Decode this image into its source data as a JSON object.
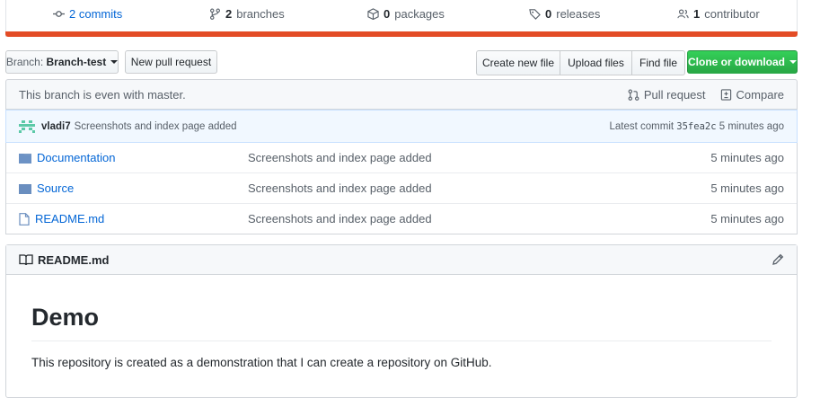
{
  "summary": {
    "commits": "2 commits",
    "branches_num": "2",
    "branches_label": "branches",
    "packages_num": "0",
    "packages_label": "packages",
    "releases_num": "0",
    "releases_label": "releases",
    "contributors_num": "1",
    "contributors_label": "contributor",
    "language_bar_color": "#e34c26"
  },
  "toolbar": {
    "branch_label": "Branch:",
    "branch_name": "Branch-test",
    "new_pr": "New pull request",
    "create_file": "Create new file",
    "upload_files": "Upload files",
    "find_file": "Find file",
    "clone": "Clone or download"
  },
  "branch_info": {
    "status": "This branch is even with master.",
    "pull_request": "Pull request",
    "compare": "Compare"
  },
  "latest_commit": {
    "author": "vladi7",
    "message": "Screenshots and index page added",
    "label": "Latest commit",
    "sha": "35fea2c",
    "age": "5 minutes ago"
  },
  "files": [
    {
      "name": "Documentation",
      "type": "folder",
      "message": "Screenshots and index page added",
      "age": "5 minutes ago"
    },
    {
      "name": "Source",
      "type": "folder",
      "message": "Screenshots and index page added",
      "age": "5 minutes ago"
    },
    {
      "name": "README.md",
      "type": "file",
      "message": "Screenshots and index page added",
      "age": "5 minutes ago"
    }
  ],
  "readme": {
    "filename": "README.md",
    "heading": "Demo",
    "body": "This repository is created as a demonstration that I can create a repository on GitHub."
  }
}
